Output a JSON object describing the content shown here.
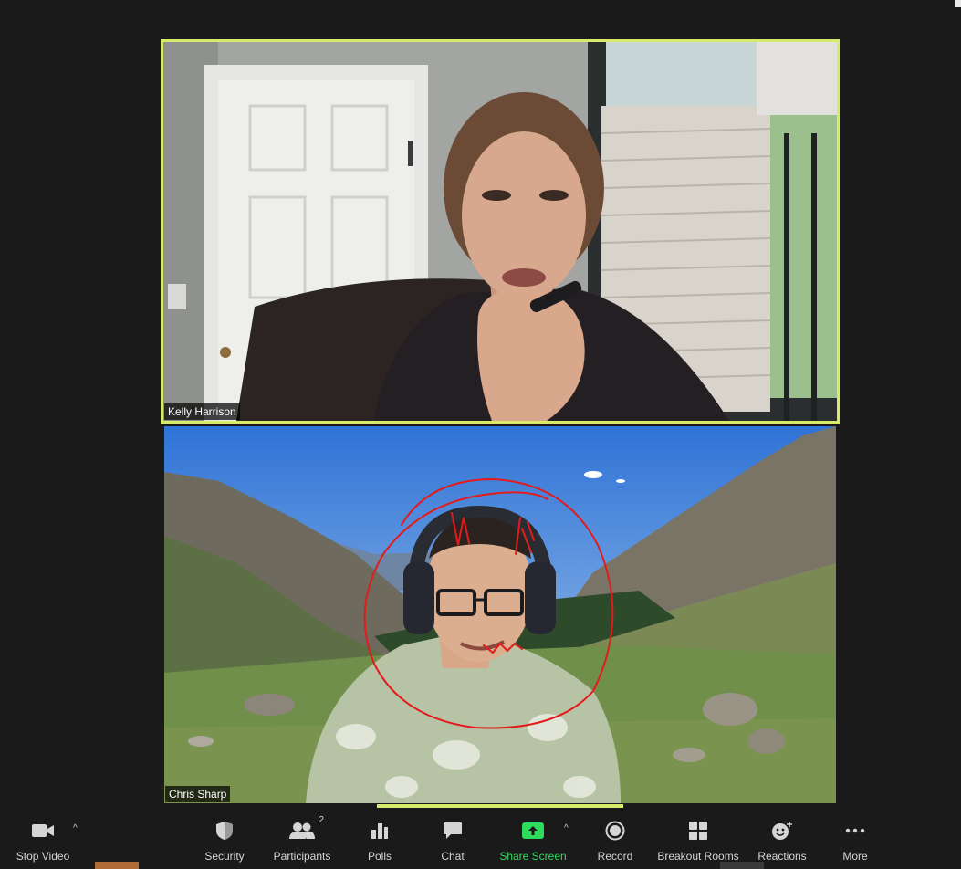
{
  "participants": [
    {
      "name": "Kelly Harrison"
    },
    {
      "name": "Chris Sharp"
    }
  ],
  "toolbar": {
    "stop_video": "Stop Video",
    "security": "Security",
    "participants": "Participants",
    "participants_count": "2",
    "polls": "Polls",
    "chat": "Chat",
    "share_screen": "Share Screen",
    "record": "Record",
    "breakout_rooms": "Breakout Rooms",
    "reactions": "Reactions",
    "more": "More"
  },
  "colors": {
    "active_speaker_border": "#d8ea6a",
    "share_screen_green": "#2ddc5c",
    "annotation_red": "#e31b1b",
    "background": "#1a1a1a"
  }
}
